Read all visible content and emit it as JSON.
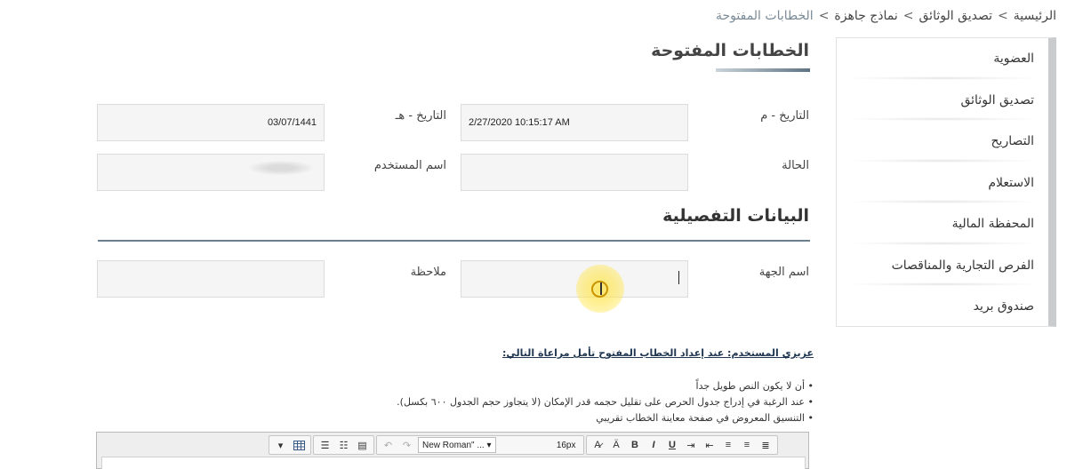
{
  "breadcrumb": {
    "items": [
      "الرئيسية",
      "تصديق الوثائق",
      "نماذج جاهزة"
    ],
    "separator": ">",
    "current": "الخطابات المفتوحة"
  },
  "sidebar": {
    "items": [
      {
        "label": "العضوية"
      },
      {
        "label": "تصديق الوثائق"
      },
      {
        "label": "التصاريح"
      },
      {
        "label": "الاستعلام"
      },
      {
        "label": "المحفظة المالية"
      },
      {
        "label": "الفرص التجارية والمناقصات"
      },
      {
        "label": "صندوق بريد"
      }
    ]
  },
  "page": {
    "title": "الخطابات المفتوحة",
    "section_title": "البيانات التفصيلية"
  },
  "form": {
    "gregorian_date": {
      "label": "التاريخ - م",
      "value": "2/27/2020 10:15:17 AM"
    },
    "hijri_date": {
      "label": "التاريخ - هـ",
      "value": "03/07/1441"
    },
    "status": {
      "label": "الحالة",
      "value": ""
    },
    "username": {
      "label": "اسم المستخدم",
      "value": ""
    },
    "entity_name": {
      "label": "اسم الجهة",
      "value": ""
    },
    "note": {
      "label": "ملاحظة",
      "value": ""
    }
  },
  "notice": {
    "title": "عزيزي المستخدم: عند إعداد الخطاب المفتوح تأمل مراعاة التالي:",
    "items": [
      "أن لا يكون النص طويل جداً",
      "عند الرغبة في إدراج جدول الحرص على تقليل حجمه قدر الإمكان (لا يتجاوز حجم الجدول ٦٠٠ بكسل).",
      "التنسيق المعروض في صفحة معاينة الخطاب تقريبي"
    ]
  },
  "editor": {
    "font_family": "New Roman\" ...",
    "font_size": "16px",
    "bold": "B",
    "italic": "I",
    "underline": "U"
  },
  "colors": {
    "sidebar_border": "#c9cbcd",
    "section_line": "#6c7f8c",
    "notice_title": "#1f3550",
    "cursor_highlight": "#ffe650"
  }
}
